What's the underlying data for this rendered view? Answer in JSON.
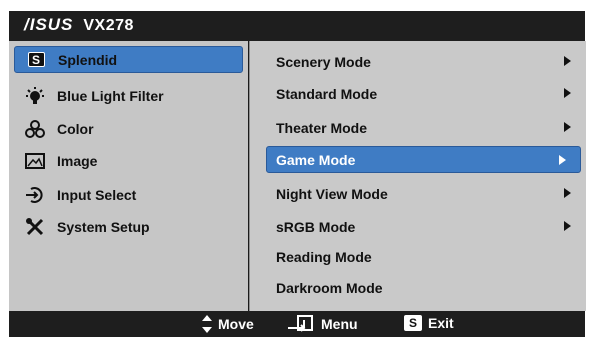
{
  "header": {
    "logo": "/ISUS",
    "model": "VX278"
  },
  "left_menu": [
    {
      "label": "Splendid",
      "icon": "splendid-s-icon",
      "selected": true
    },
    {
      "label": "Blue Light Filter",
      "icon": "light-bulb-icon",
      "selected": false
    },
    {
      "label": "Color",
      "icon": "color-circles-icon",
      "selected": false
    },
    {
      "label": "Image",
      "icon": "image-icon",
      "selected": false
    },
    {
      "label": "Input Select",
      "icon": "input-select-icon",
      "selected": false
    },
    {
      "label": "System Setup",
      "icon": "tools-icon",
      "selected": false
    }
  ],
  "right_menu": [
    {
      "label": "Scenery Mode",
      "has_submenu": true,
      "selected": false
    },
    {
      "label": "Standard Mode",
      "has_submenu": true,
      "selected": false
    },
    {
      "label": "Theater Mode",
      "has_submenu": true,
      "selected": false
    },
    {
      "label": "Game Mode",
      "has_submenu": true,
      "selected": true
    },
    {
      "label": "Night View Mode",
      "has_submenu": true,
      "selected": false
    },
    {
      "label": "sRGB Mode",
      "has_submenu": true,
      "selected": false
    },
    {
      "label": "Reading Mode",
      "has_submenu": false,
      "selected": false
    },
    {
      "label": "Darkroom Mode",
      "has_submenu": false,
      "selected": false
    }
  ],
  "footer": {
    "move_label": "Move",
    "menu_label": "Menu",
    "exit_label": "Exit",
    "exit_badge": "S"
  },
  "badges": {
    "splendid_badge": "S"
  },
  "colors": {
    "accent": "#3f7cc4",
    "panel": "#c6c6c6",
    "bar": "#1e1e1e"
  }
}
